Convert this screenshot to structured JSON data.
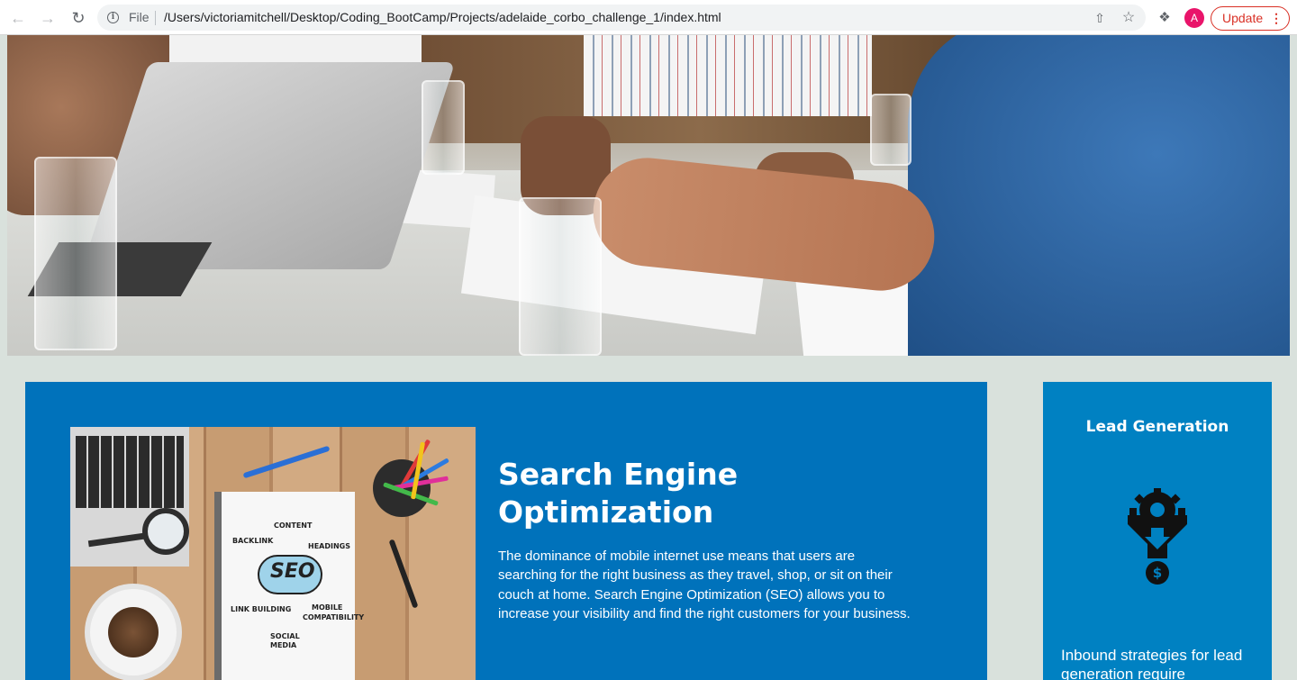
{
  "browser": {
    "scheme_label": "File",
    "url": "/Users/victoriamitchell/Desktop/Coding_BootCamp/Projects/adelaide_corbo_challenge_1/index.html",
    "avatar_letter": "A",
    "update_label": "Update",
    "icons": [
      "back-arrow-icon",
      "forward-arrow-icon",
      "reload-icon",
      "info-icon",
      "share-icon",
      "star-icon",
      "puzzle-extension-icon",
      "more-vert-icon"
    ]
  },
  "hero": {
    "image": "business-meeting-photo"
  },
  "seo": {
    "title": "Search Engine Optimization",
    "body": "The dominance of mobile internet use means that users are searching for the right business as they travel, shop, or sit on their couch at home. Search Engine Optimization (SEO) allows you to increase your visibility and find the right customers for your business.",
    "image_words": {
      "center": "SEO",
      "content": "CONTENT",
      "backlink": "BACKLINK",
      "headings": "HEADINGS",
      "link_building": "LINK BUILDING",
      "mobile": "MOBILE",
      "compatibility": "COMPATIBILITY",
      "social": "SOCIAL",
      "media": "MEDIA"
    }
  },
  "lead": {
    "title": "Lead Generation",
    "icon": "gear-funnel-dollar-icon",
    "body": "Inbound strategies for lead generation require"
  },
  "colors": {
    "page_bg": "#d9e1dc",
    "seo_bg": "#0072bb",
    "lead_bg": "#0081c2",
    "update_red": "#d93025"
  }
}
